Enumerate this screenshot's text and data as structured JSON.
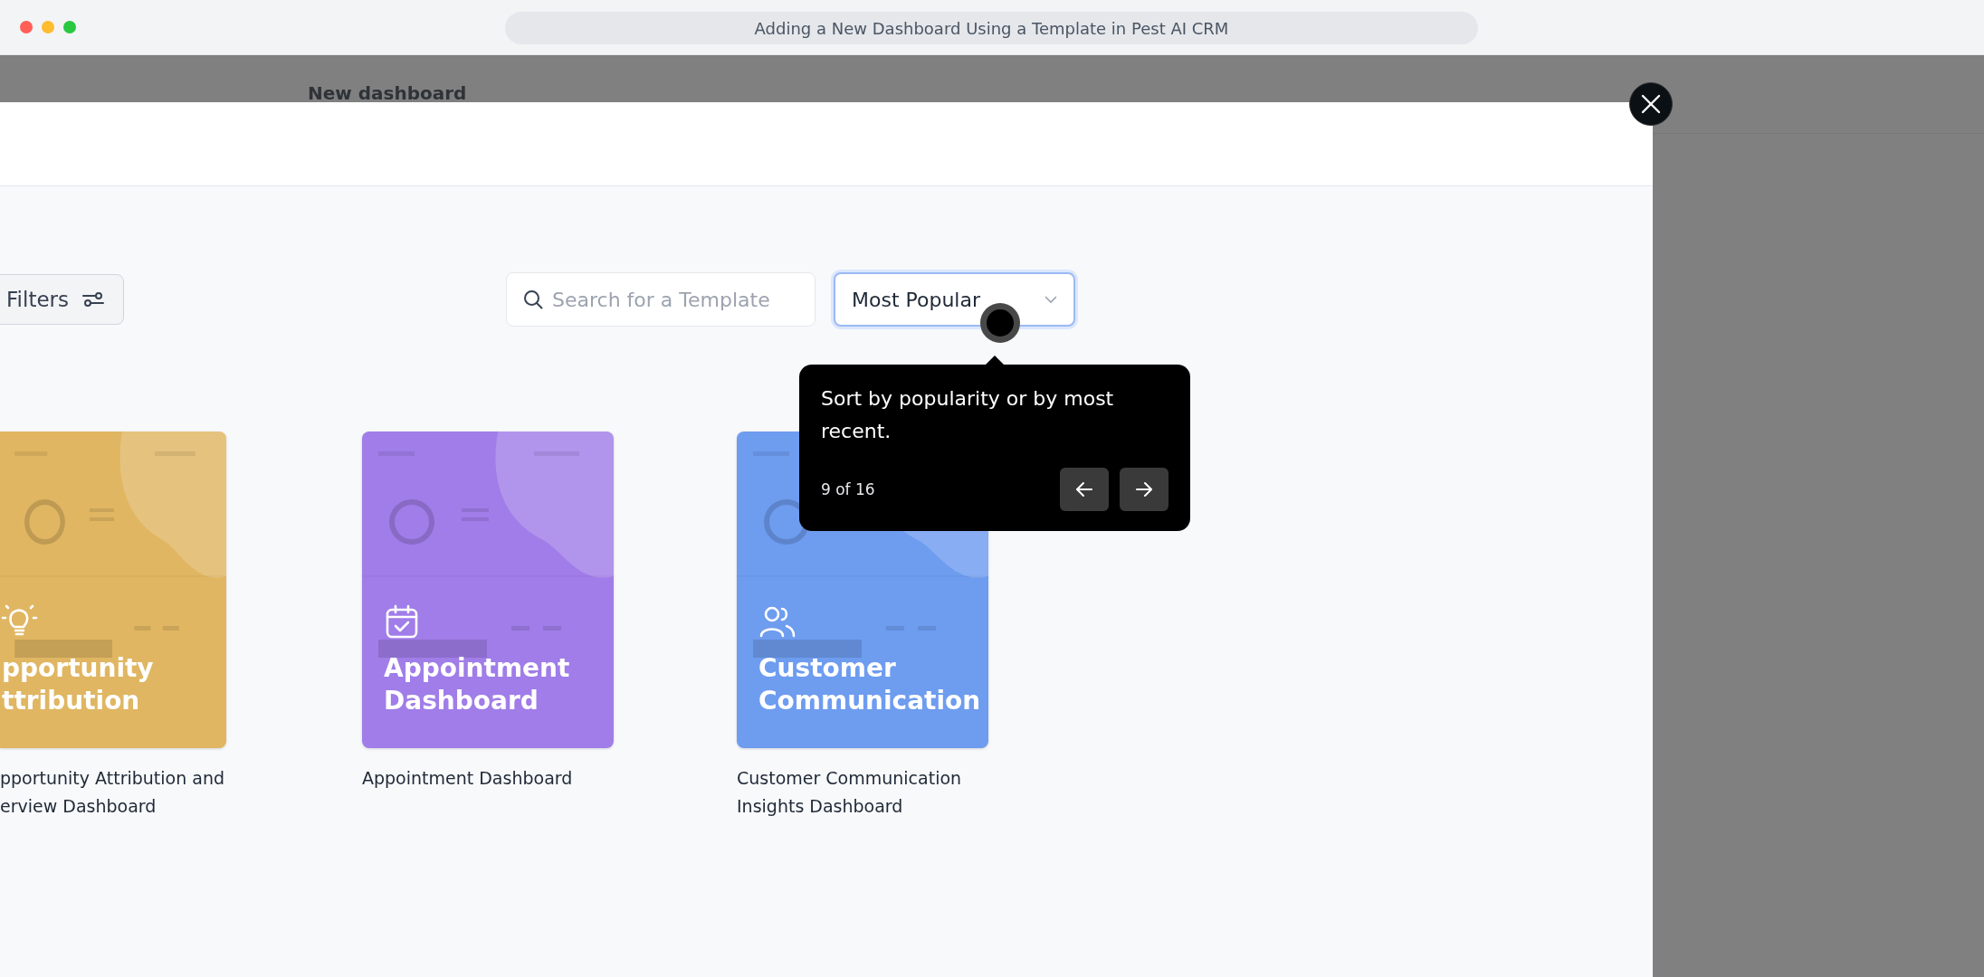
{
  "window": {
    "title": "Adding a New Dashboard Using a Template in Pest AI CRM"
  },
  "background_page": {
    "title": "New dashboard"
  },
  "toolbar": {
    "filters_label": "Filters",
    "search": {
      "placeholder": "Search for a Template"
    },
    "sort": {
      "value": "Most Popular"
    }
  },
  "tooltip": {
    "text": "Sort by popularity or by most recent.",
    "progress": "9 of 16"
  },
  "templates": [
    {
      "kind": "lightbulb",
      "color": "#e0b662",
      "title_lines": [
        "pportunity",
        "ttribution"
      ],
      "caption_lines": [
        "pportunity Attribution and",
        "erview Dashboard"
      ]
    },
    {
      "kind": "calendar",
      "color": "#a07de8",
      "title_lines": [
        "Appointment",
        "Dashboard"
      ],
      "caption_lines": [
        "Appointment Dashboard"
      ]
    },
    {
      "kind": "users",
      "color": "#6e9cef",
      "title_lines": [
        "Customer",
        "Communication"
      ],
      "caption_lines": [
        "Customer Communication",
        "Insights Dashboard"
      ]
    }
  ]
}
